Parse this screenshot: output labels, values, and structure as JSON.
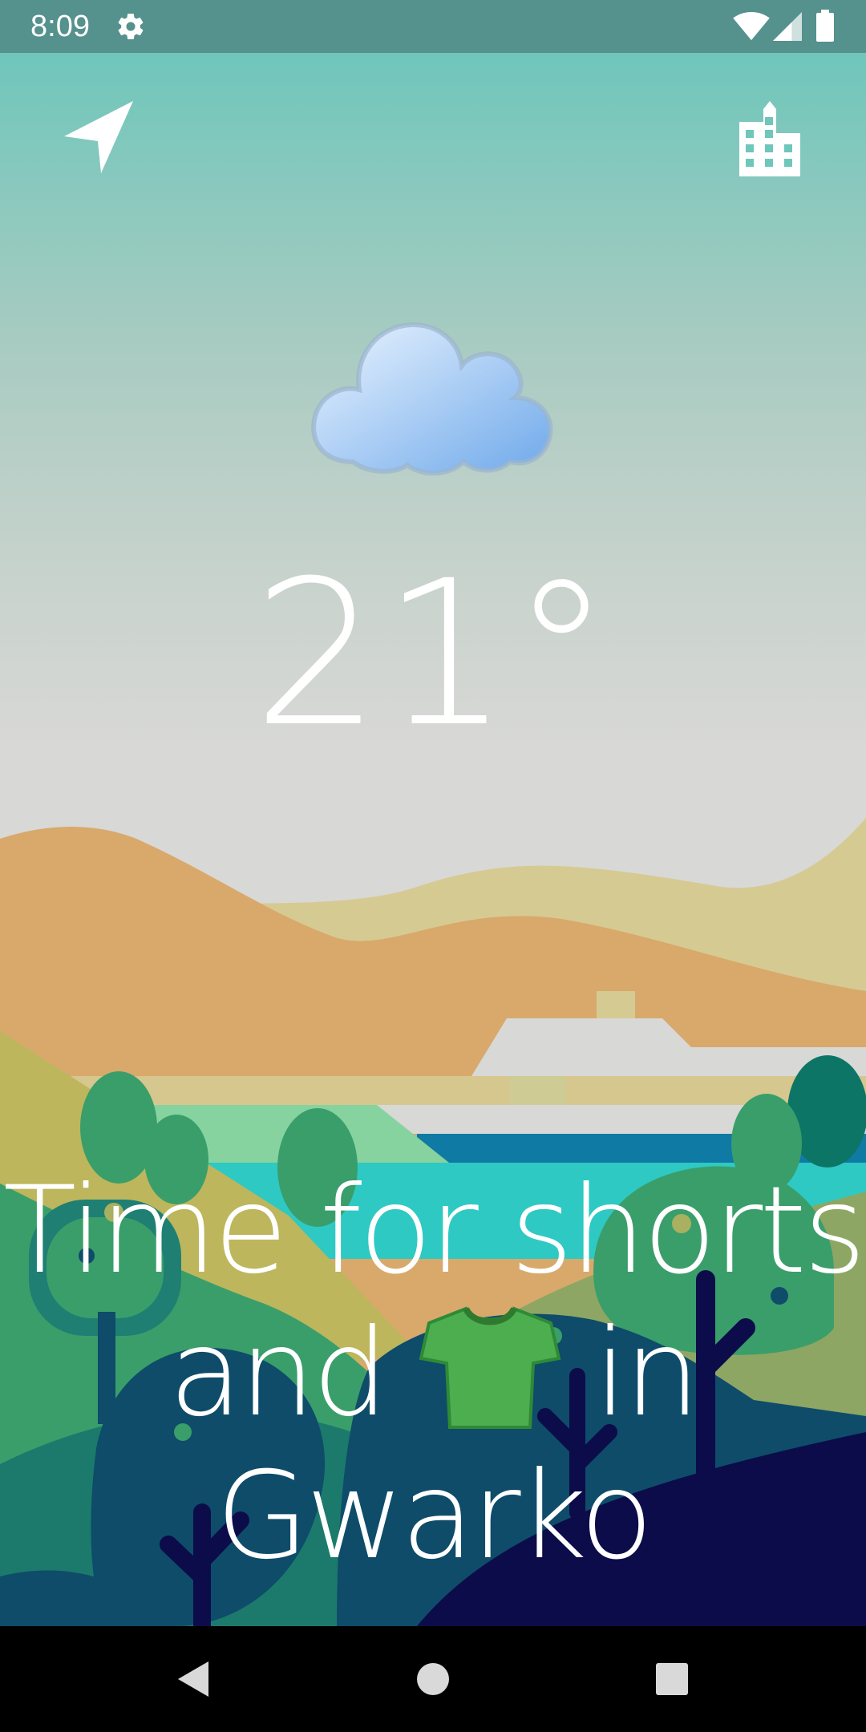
{
  "status_bar": {
    "time": "8:09",
    "icons": [
      "gear-icon",
      "wifi-icon",
      "signal-icon",
      "battery-icon"
    ]
  },
  "toolbar": {
    "location_icon": "navigation-arrow-icon",
    "city_icon": "city-buildings-icon"
  },
  "weather": {
    "condition_icon": "cloud-icon",
    "temperature": "21°"
  },
  "recommendation": {
    "line1": "Time for shorts",
    "line2_start": "and",
    "clothing_icon": "tshirt-icon",
    "line2_end": "in",
    "location": "Gwarko"
  },
  "navigation_bar": {
    "icons": [
      "back-icon",
      "home-icon",
      "recents-icon"
    ]
  },
  "colors": {
    "status_bar": "#55918d",
    "sky_top": "#6fc6bb",
    "sky_bottom": "#d8d8d6",
    "shirt": "#4cae4f",
    "text": "#ffffff"
  }
}
